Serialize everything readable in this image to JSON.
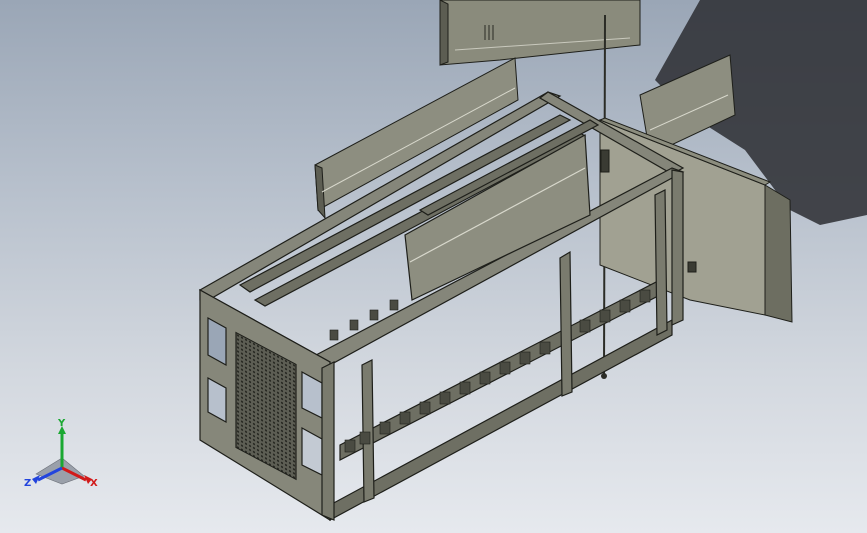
{
  "viewport": {
    "background_top": "#9aa6b6",
    "background_bottom": "#e6e9ee",
    "model_color": "#7a7b6e",
    "edge_color": "#1e1f1a"
  },
  "triad": {
    "x_label": "X",
    "y_label": "Y",
    "z_label": "Z",
    "x_color": "#d11a1a",
    "y_color": "#1aa832",
    "z_color": "#2244dd"
  }
}
